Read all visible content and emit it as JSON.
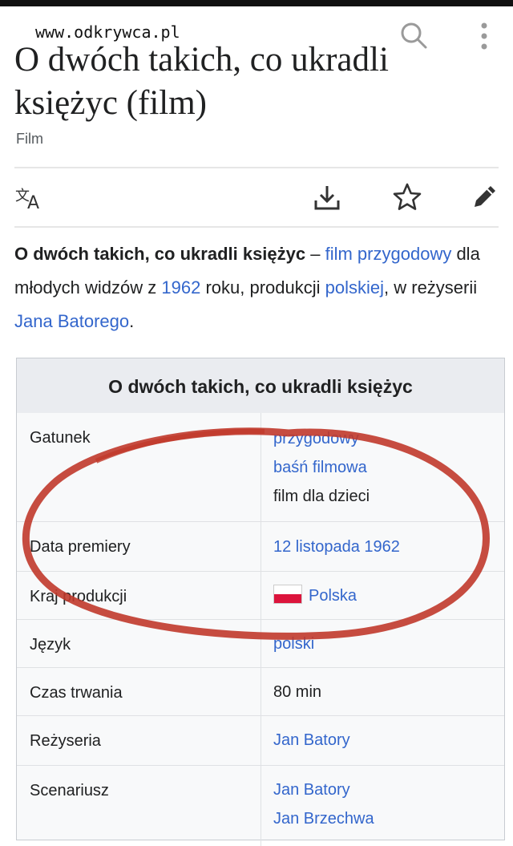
{
  "watermark": "www.odkrywca.pl",
  "title": "O dwóch takich, co ukradli księżyc (film)",
  "subtitle": "Film",
  "toolbar": {
    "icons": [
      "translate-icon",
      "download-icon",
      "star-icon",
      "edit-icon"
    ]
  },
  "intro": {
    "bold": "O dwóch takich, co ukradli księżyc",
    "dash": " – ",
    "link1": "film przygodowy",
    "t1": " dla młodych widzów z ",
    "link2": "1962",
    "t2": " roku, produkcji ",
    "link3": "polskiej",
    "t3": ", w reżyserii ",
    "link4": "Jana Batorego",
    "t4": "."
  },
  "infobox": {
    "title": "O dwóch takich, co ukradli księżyc",
    "rows": [
      {
        "label": "Gatunek",
        "values": [
          "przygodowy",
          "baśń filmowa",
          "film dla dzieci"
        ]
      },
      {
        "label": "Data premiery",
        "values": [
          "12 listopada 1962"
        ]
      },
      {
        "label": "Kraj produkcji",
        "values": [
          "Polska"
        ]
      },
      {
        "label": "Język",
        "values": [
          "polski"
        ]
      },
      {
        "label": "Czas trwania",
        "values": [
          "80 min"
        ]
      },
      {
        "label": "Reżyseria",
        "values": [
          "Jan Batory"
        ]
      },
      {
        "label": "Scenariusz",
        "values": [
          "Jan Batory",
          "Jan Brzechwa"
        ]
      }
    ]
  },
  "colors": {
    "link": "#3366cc",
    "annotation": "#c0392b",
    "infobox_bg": "#f8f9fa"
  }
}
